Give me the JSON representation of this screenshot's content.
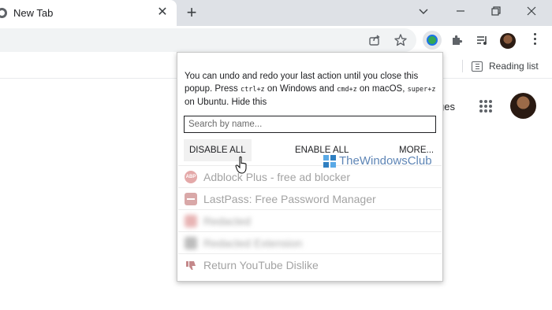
{
  "browser": {
    "tab": {
      "title": "New Tab",
      "close": "✕"
    },
    "new_tab": "+",
    "window_controls": [
      "chevron-down-icon",
      "minimize-icon",
      "restore-icon",
      "close-icon"
    ]
  },
  "toolbar": {
    "icons": [
      "share-icon",
      "star-icon",
      "extension-active-icon",
      "puzzle-icon",
      "media-queue-icon",
      "avatar",
      "kebab-menu-icon"
    ]
  },
  "bookmarks": {
    "reading_list": "Reading list"
  },
  "ntp": {
    "images_link": "ges"
  },
  "popup": {
    "message_parts": {
      "p1": "You can undo and redo your last action until you close this popup. Press ",
      "key1": "ctrl+z",
      "p2": " on Windows and ",
      "key2": "cmd+z",
      "p3": " on macOS, ",
      "key3": "super+z",
      "p4": " on Ubuntu. Hide this"
    },
    "search_placeholder": "Search by name...",
    "actions": {
      "disable_all": "DISABLE ALL",
      "enable_all": "ENABLE ALL",
      "more": "MORE..."
    },
    "extensions": [
      {
        "name": "Adblock Plus - free ad blocker",
        "icon": "adblock-plus-icon",
        "icon_text": "ABP"
      },
      {
        "name": "LastPass: Free Password Manager",
        "icon": "lastpass-icon"
      },
      {
        "name": "Redacted",
        "icon": "redacted-icon",
        "blurred": true
      },
      {
        "name": "Redacted Extension",
        "icon": "redacted-icon",
        "blurred": true
      },
      {
        "name": "Return YouTube Dislike",
        "icon": "thumbs-down-icon"
      }
    ]
  },
  "watermark": {
    "text": "TheWindowsClub"
  },
  "colors": {
    "tabstrip": "#dee1e6",
    "watermark": "#5f86b6",
    "extension_text": "#a3a3a3"
  }
}
